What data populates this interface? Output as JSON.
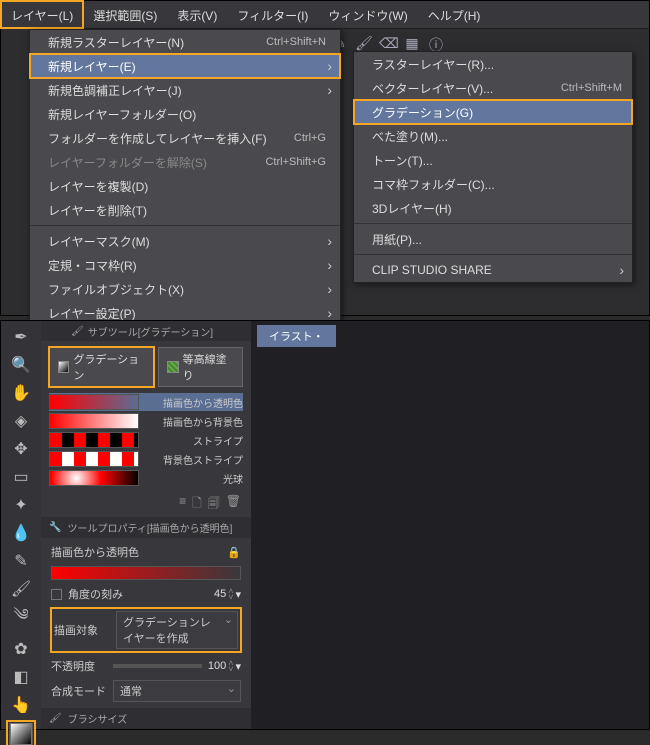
{
  "menubar": {
    "layer": "レイヤー(L)",
    "select": "選択範囲(S)",
    "view": "表示(V)",
    "filter": "フィルター(I)",
    "window": "ウィンドウ(W)",
    "help": "ヘルプ(H)"
  },
  "layer_menu": {
    "new_raster": "新規ラスターレイヤー(N)",
    "new_raster_acc": "Ctrl+Shift+N",
    "new_layer": "新規レイヤー(E)",
    "new_adjust": "新規色調補正レイヤー(J)",
    "new_folder": "新規レイヤーフォルダー(O)",
    "create_folder_insert": "フォルダーを作成してレイヤーを挿入(F)",
    "create_folder_insert_acc": "Ctrl+G",
    "ungroup_folder": "レイヤーフォルダーを解除(S)",
    "ungroup_folder_acc": "Ctrl+Shift+G",
    "duplicate": "レイヤーを複製(D)",
    "delete": "レイヤーを削除(T)",
    "mask": "レイヤーマスク(M)",
    "ruler_frame": "定規・コマ枠(R)",
    "file_object": "ファイルオブジェクト(X)",
    "settings": "レイヤー設定(P)"
  },
  "new_layer_submenu": {
    "raster": "ラスターレイヤー(R)...",
    "vector": "ベクターレイヤー(V)...",
    "vector_acc": "Ctrl+Shift+M",
    "gradient": "グラデーション(G)",
    "fill": "べた塗り(M)...",
    "tone": "トーン(T)...",
    "frame_folder": "コマ枠フォルダー(C)...",
    "three_d": "3Dレイヤー(H)",
    "paper": "用紙(P)...",
    "share": "CLIP STUDIO SHARE"
  },
  "bottom": {
    "subtool_title": "サブツール[グラデーション]",
    "doc_tab": "イラスト・",
    "tabs": {
      "gradient": "グラデーション",
      "contour": "等高線塗り"
    },
    "gradients": [
      {
        "label": "描画色から透明色"
      },
      {
        "label": "描画色から背景色"
      },
      {
        "label": "ストライプ"
      },
      {
        "label": "背景色ストライプ"
      },
      {
        "label": "光球"
      }
    ],
    "toolprop_title": "ツールプロパティ[描画色から透明色]",
    "current_gradient": "描画色から透明色",
    "angle_step_label": "角度の刻み",
    "angle_step_value": "45",
    "draw_target_label": "描画対象",
    "draw_target_value": "グラデーションレイヤーを作成",
    "opacity_label": "不透明度",
    "opacity_value": "100",
    "blend_label": "合成モード",
    "blend_value": "通常",
    "brush_size": "ブラシサイズ"
  }
}
